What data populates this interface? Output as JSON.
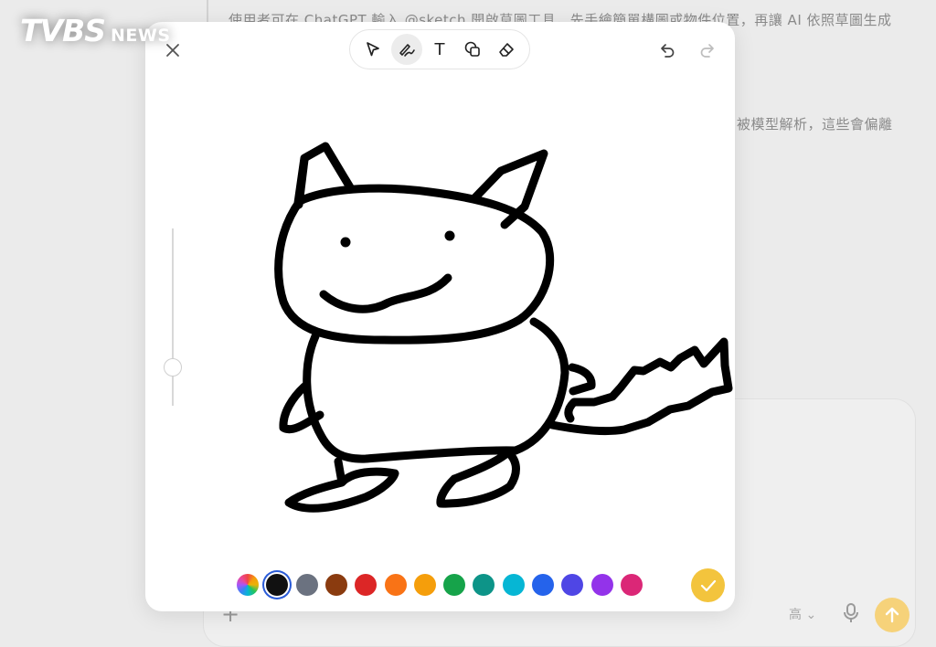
{
  "background": {
    "line_1": "使用者可在 ChatGPT 輸入 @sketch 開啟草圖工具，先手繪簡單構圖或物件位置，再讓 AI 依照草圖生成",
    "line_2": "被模型解析，這些會偏離",
    "composer": {
      "plus_label": "+",
      "quality_label": "高 ⌄"
    }
  },
  "logo": {
    "main": "TVBS",
    "sub": "NEWS"
  },
  "toolbar": {
    "tools": [
      {
        "name": "select",
        "icon": "cursor-icon",
        "active": false
      },
      {
        "name": "draw",
        "icon": "pen-icon",
        "active": true
      },
      {
        "name": "text",
        "icon": "text-icon",
        "active": false
      },
      {
        "name": "shapes",
        "icon": "shapes-icon",
        "active": false
      },
      {
        "name": "eraser",
        "icon": "eraser-icon",
        "active": false
      }
    ],
    "text_glyph": "T"
  },
  "palette": {
    "selected_index": 1,
    "colors": [
      "rainbow",
      "#111111",
      "#6b7280",
      "#8a3b0f",
      "#dc2626",
      "#f97316",
      "#f59e0b",
      "#16a34a",
      "#0d9488",
      "#06b6d4",
      "#2563eb",
      "#4f46e5",
      "#9333ea",
      "#db2777"
    ]
  },
  "stroke": {
    "color": "#000000"
  },
  "accent": {
    "confirm": "#f3c43d",
    "send": "#f6d27a"
  }
}
